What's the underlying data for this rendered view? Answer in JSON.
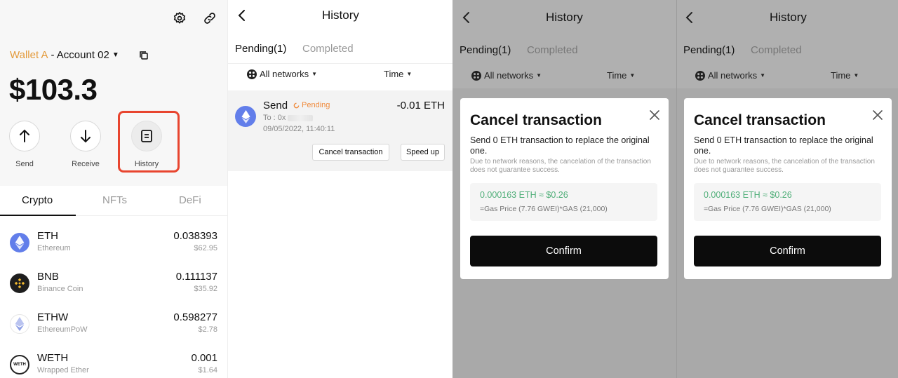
{
  "wallet": {
    "wallet_name": "Wallet A",
    "account": " - Account 02",
    "balance": "$103.3",
    "actions": {
      "send": "Send",
      "receive": "Receive",
      "history": "History"
    },
    "tabs": {
      "crypto": "Crypto",
      "nfts": "NFTs",
      "defi": "DeFi"
    },
    "coins": [
      {
        "symbol": "ETH",
        "name": "Ethereum",
        "amount": "0.038393",
        "usd": "$62.95"
      },
      {
        "symbol": "BNB",
        "name": "Binance Coin",
        "amount": "0.111137",
        "usd": "$35.92"
      },
      {
        "symbol": "ETHW",
        "name": "EthereumPoW",
        "amount": "0.598277",
        "usd": "$2.78"
      },
      {
        "symbol": "WETH",
        "name": "Wrapped Ether",
        "amount": "0.001",
        "usd": "$1.64"
      }
    ],
    "weth_badge": "WETH"
  },
  "history": {
    "title": "History",
    "tab_pending": "Pending(1)",
    "tab_completed": "Completed",
    "network_filter": "All networks",
    "time_filter": "Time",
    "tx": {
      "type": "Send",
      "status": "Pending",
      "to_prefix": "To : 0x",
      "datetime": "09/05/2022, 11:40:11",
      "amount": "-0.01 ETH",
      "cancel_label": "Cancel transaction",
      "speedup_label": "Speed up"
    }
  },
  "modal": {
    "title": "Cancel transaction",
    "description": "Send 0 ETH transaction to replace the original one.",
    "note": "Due to network reasons, the cancelation of the transaction does not guarantee success.",
    "gas_value": "0.000163 ETH ≈ $0.26",
    "gas_calc": "=Gas Price (7.76 GWEI)*GAS (21,000)",
    "confirm_label": "Confirm"
  },
  "colors": {
    "accent_orange": "#e39a3b",
    "highlight_red": "#e8452f",
    "pending_orange": "#f08a3b",
    "gas_green": "#4fae78",
    "eth_blue": "#627eea",
    "bnb_yellow": "#f3ba2f"
  }
}
